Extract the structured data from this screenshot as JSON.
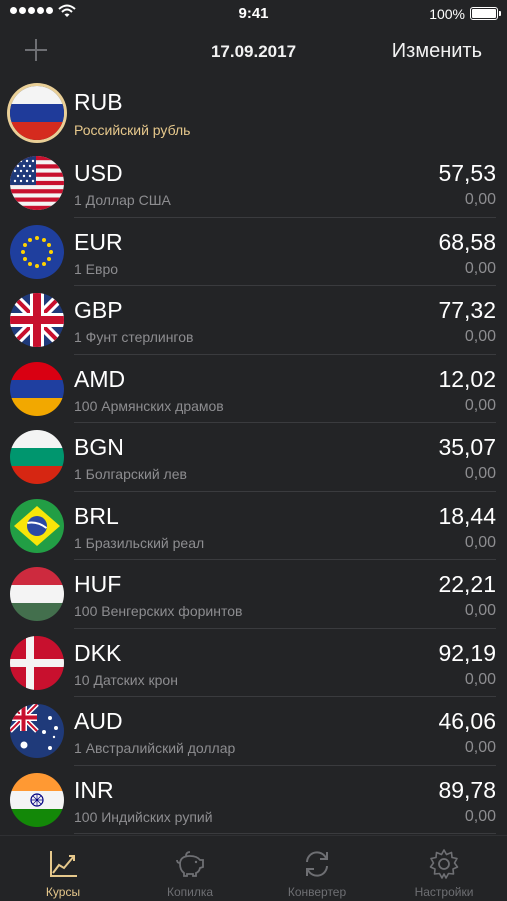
{
  "status_bar": {
    "time": "9:41",
    "battery": "100%"
  },
  "nav": {
    "date": "17.09.2017",
    "edit_label": "Изменить"
  },
  "base_currency": {
    "code": "RUB",
    "name": "Российский рубль"
  },
  "currencies": [
    {
      "code": "USD",
      "name": "1 Доллар США",
      "rate": "57,53",
      "change": "0,00"
    },
    {
      "code": "EUR",
      "name": "1 Евро",
      "rate": "68,58",
      "change": "0,00"
    },
    {
      "code": "GBP",
      "name": "1 Фунт стерлингов",
      "rate": "77,32",
      "change": "0,00"
    },
    {
      "code": "AMD",
      "name": "100 Армянских драмов",
      "rate": "12,02",
      "change": "0,00"
    },
    {
      "code": "BGN",
      "name": "1 Болгарский лев",
      "rate": "35,07",
      "change": "0,00"
    },
    {
      "code": "BRL",
      "name": "1 Бразильский реал",
      "rate": "18,44",
      "change": "0,00"
    },
    {
      "code": "HUF",
      "name": "100 Венгерских форинтов",
      "rate": "22,21",
      "change": "0,00"
    },
    {
      "code": "DKK",
      "name": "10 Датских крон",
      "rate": "92,19",
      "change": "0,00"
    },
    {
      "code": "AUD",
      "name": "1 Австралийский доллар",
      "rate": "46,06",
      "change": "0,00"
    },
    {
      "code": "INR",
      "name": "100 Индийских рупий",
      "rate": "89,78",
      "change": "0,00"
    }
  ],
  "tabs": [
    {
      "label": "Курсы",
      "icon": "chart-icon",
      "active": true
    },
    {
      "label": "Копилка",
      "icon": "piggy-bank-icon",
      "active": false
    },
    {
      "label": "Конвертер",
      "icon": "sync-icon",
      "active": false
    },
    {
      "label": "Настройки",
      "icon": "gear-icon",
      "active": false
    }
  ],
  "colors": {
    "background": "#232426",
    "accent": "#e6c88c",
    "secondary_text": "#8d8d90"
  }
}
